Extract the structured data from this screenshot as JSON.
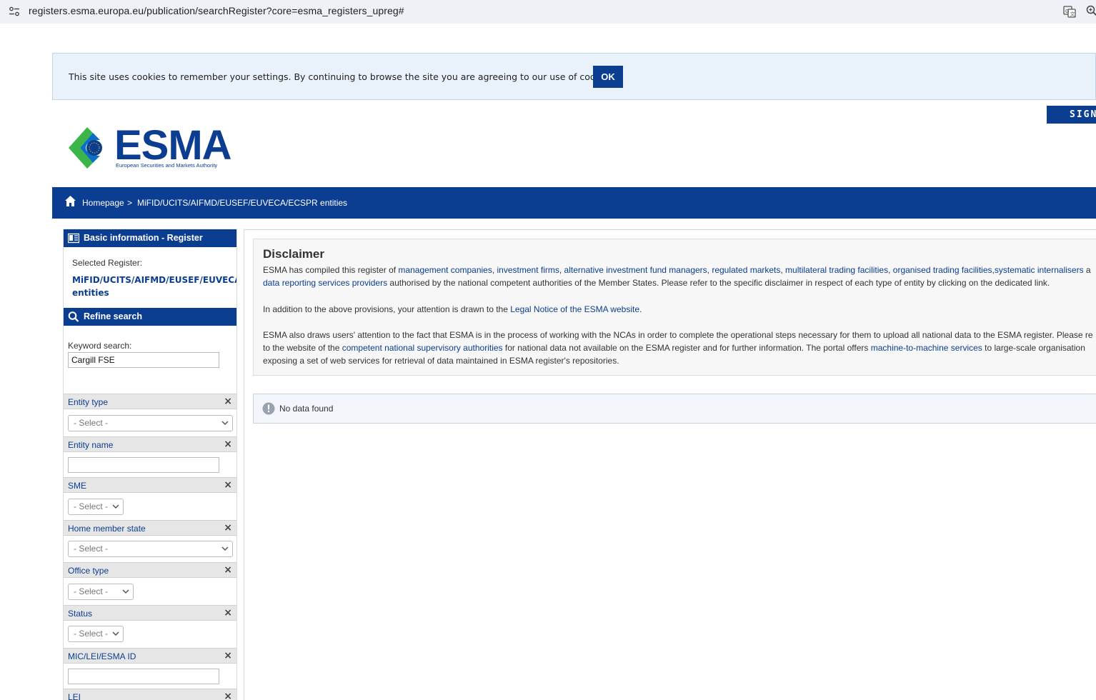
{
  "browser": {
    "url": "registers.esma.europa.eu/publication/searchRegister?core=esma_registers_upreg#"
  },
  "cookie": {
    "message": "This site uses cookies to remember your settings. By continuing to browse the site you are agreeing to our use of cookies.",
    "ok_label": "OK"
  },
  "header": {
    "signin_label": "SIGN",
    "logo_word": "ESMA",
    "logo_sub": "European Securities and Markets Authority"
  },
  "breadcrumb": {
    "home": "Homepage",
    "separator": ">",
    "current": "MiFID/UCITS/AIFMD/EUSEF/EUVECA/ECSPR entities"
  },
  "sidebar": {
    "basic_info_title": "Basic information - Register",
    "selected_register_label": "Selected Register:",
    "selected_register_value": "MiFID/UCITS/AIFMD/EUSEF/EUVECA/ECSPR entities",
    "refine_title": "Refine search",
    "keyword_label": "Keyword search:",
    "keyword_value": "Cargill FSE",
    "facets": {
      "entity_type": {
        "label": "Entity type",
        "value": "- Select -"
      },
      "entity_name": {
        "label": "Entity name"
      },
      "sme": {
        "label": "SME",
        "value": "- Select -"
      },
      "home_member_state": {
        "label": "Home member state",
        "value": "- Select -"
      },
      "office_type": {
        "label": "Office type",
        "value": "- Select -"
      },
      "status": {
        "label": "Status",
        "value": "- Select -"
      },
      "mic_lei": {
        "label": "MIC/LEI/ESMA ID"
      },
      "lei": {
        "label": "LEI"
      }
    },
    "clear_symbol": "×"
  },
  "main": {
    "disclaimer_title": "Disclaimer",
    "p1": {
      "t0": "ESMA has compiled this register of ",
      "l1": "management companies",
      "t1": ", ",
      "l2": "investment firms",
      "t2": ", ",
      "l3": "alternative investment fund managers",
      "t3": ", ",
      "l4": "regulated markets",
      "t4": ", ",
      "l5": "multilateral trading facilities",
      "t5": ", ",
      "l6": "organised trading facilities",
      "t6": ",",
      "l7": "systematic internalisers",
      "t7": " a",
      "l8": "data reporting services providers",
      "t8": " authorised by the national competent authorities of the Member States. Please refer to the specific disclaimer in respect of each type of entity by clicking on the dedicated link."
    },
    "p2": {
      "t0": "In addition to the above provisions, your attention is drawn to the ",
      "l1": "Legal Notice of the ESMA website",
      "t1": "."
    },
    "p3": {
      "t0": "ESMA also draws users' attention to the fact that ESMA is in the process of working with the NCAs in order to complete the operational steps necessary for them to upload all national data to the ESMA register. Please re",
      "t1": "to the website of the ",
      "l1": "competent national supervisory authorities",
      "t2": " for national data not available on the ESMA register and for further information. The portal offers ",
      "l2": "machine-to-machine services",
      "t3": " to large-scale organisation",
      "t4": "exposing a set of web services for retrieval of data maintained in ESMA register's repositories."
    },
    "no_data": "No data found"
  }
}
